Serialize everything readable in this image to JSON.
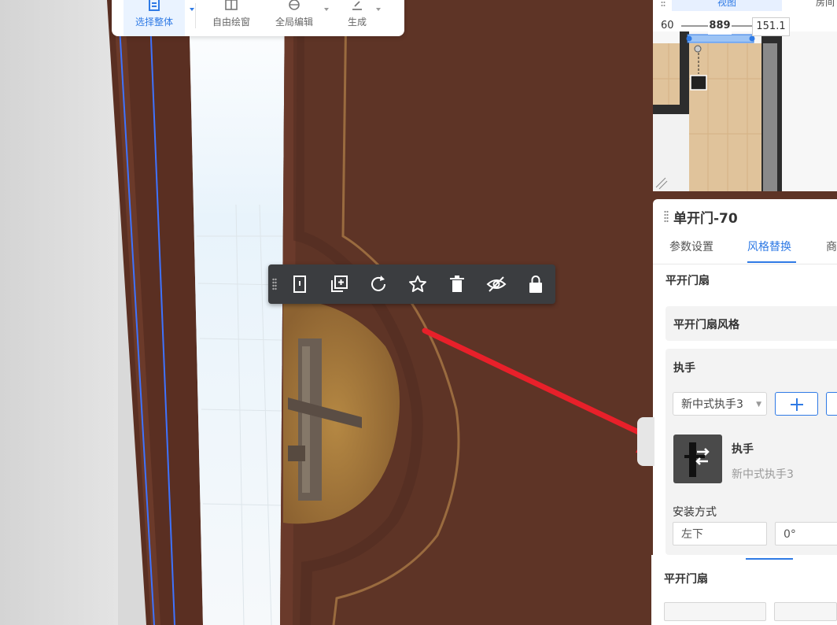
{
  "top_toolbar": {
    "buttons": [
      {
        "label": "选择整体",
        "icon": "select-whole-icon",
        "active": true
      },
      {
        "label": "自由绘窗",
        "icon": "free-draw-window-icon"
      },
      {
        "label": "全局编辑",
        "icon": "global-edit-icon"
      },
      {
        "label": "生成",
        "icon": "generate-icon"
      }
    ]
  },
  "object_toolbar": {
    "icons": [
      "grip-icon",
      "door-icon",
      "duplicate-icon",
      "rotate-icon",
      "favorite-star-icon",
      "delete-icon",
      "hide-icon",
      "lock-icon"
    ]
  },
  "minimap": {
    "tabs": [
      "视图",
      "房间"
    ],
    "active_tab": 0,
    "dimensions": {
      "left": "60",
      "width": "889",
      "right": "151.1"
    }
  },
  "properties": {
    "title": "单开门-70",
    "tabs": [
      "参数设置",
      "风格替换",
      "商"
    ],
    "active_tab": 1,
    "section_title": "平开门扇",
    "style_row": "平开门扇风格",
    "handle": {
      "heading": "执手",
      "select_value": "新中式执手3",
      "add_button_icon": "plus-icon",
      "item_title": "执手",
      "item_subtitle": "新中式执手3"
    },
    "install": {
      "label": "安装方式",
      "position": "左下",
      "angle": "0°"
    }
  },
  "panel2": {
    "title": "平开门扇"
  },
  "colors": {
    "accent": "#2f7ae5",
    "door_wood": "#5e3426",
    "toolbar_dark": "#3b3d40",
    "arrow_red": "#e8202a"
  }
}
